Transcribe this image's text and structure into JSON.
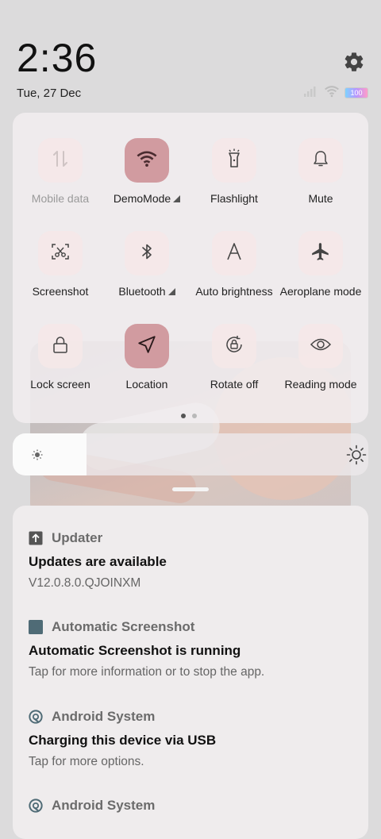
{
  "status_bar": {
    "time": "2:36",
    "date": "Tue, 27 Dec",
    "battery_level": "100",
    "icons": [
      "signal-icon",
      "wifi-icon",
      "battery-icon"
    ]
  },
  "quick_settings": {
    "tiles": [
      {
        "label": "Mobile data",
        "icon": "mobile-data-icon",
        "active": false,
        "disabled": true
      },
      {
        "label": "DemoMode",
        "icon": "wifi-icon",
        "active": true,
        "expandable": true
      },
      {
        "label": "Flashlight",
        "icon": "flashlight-icon",
        "active": false
      },
      {
        "label": "Mute",
        "icon": "bell-icon",
        "active": false
      },
      {
        "label": "Screenshot",
        "icon": "screenshot-icon",
        "active": false
      },
      {
        "label": "Bluetooth",
        "icon": "bluetooth-icon",
        "active": false,
        "expandable": true
      },
      {
        "label": "Auto brightness",
        "icon": "auto-brightness-icon",
        "active": false
      },
      {
        "label": "Aeroplane mode",
        "icon": "airplane-icon",
        "active": false
      },
      {
        "label": "Lock screen",
        "icon": "lock-icon",
        "active": false
      },
      {
        "label": "Location",
        "icon": "location-icon",
        "active": true
      },
      {
        "label": "Rotate off",
        "icon": "rotate-lock-icon",
        "active": false
      },
      {
        "label": "Reading mode",
        "icon": "eye-icon",
        "active": false
      }
    ],
    "page_count": 2,
    "current_page": 1
  },
  "brightness": {
    "level": 0.21
  },
  "notifications": [
    {
      "app": "Updater",
      "icon": "update-arrow-icon",
      "title": "Updates are available",
      "text": "V12.0.8.0.QJOINXM"
    },
    {
      "app": "Automatic Screenshot",
      "icon": "screenshot-app-icon",
      "title": "Automatic Screenshot is running",
      "text": "Tap for more information or to stop the app."
    },
    {
      "app": "Android System",
      "icon": "android-system-icon",
      "title": "Charging this device via USB",
      "text": "Tap for more options."
    },
    {
      "app": "Android System",
      "icon": "android-system-icon",
      "title": "",
      "text": ""
    }
  ],
  "colors": {
    "tile_active": "#d19ba0",
    "tile_inactive": "#f5e8e8",
    "background": "#dcdbdc"
  }
}
